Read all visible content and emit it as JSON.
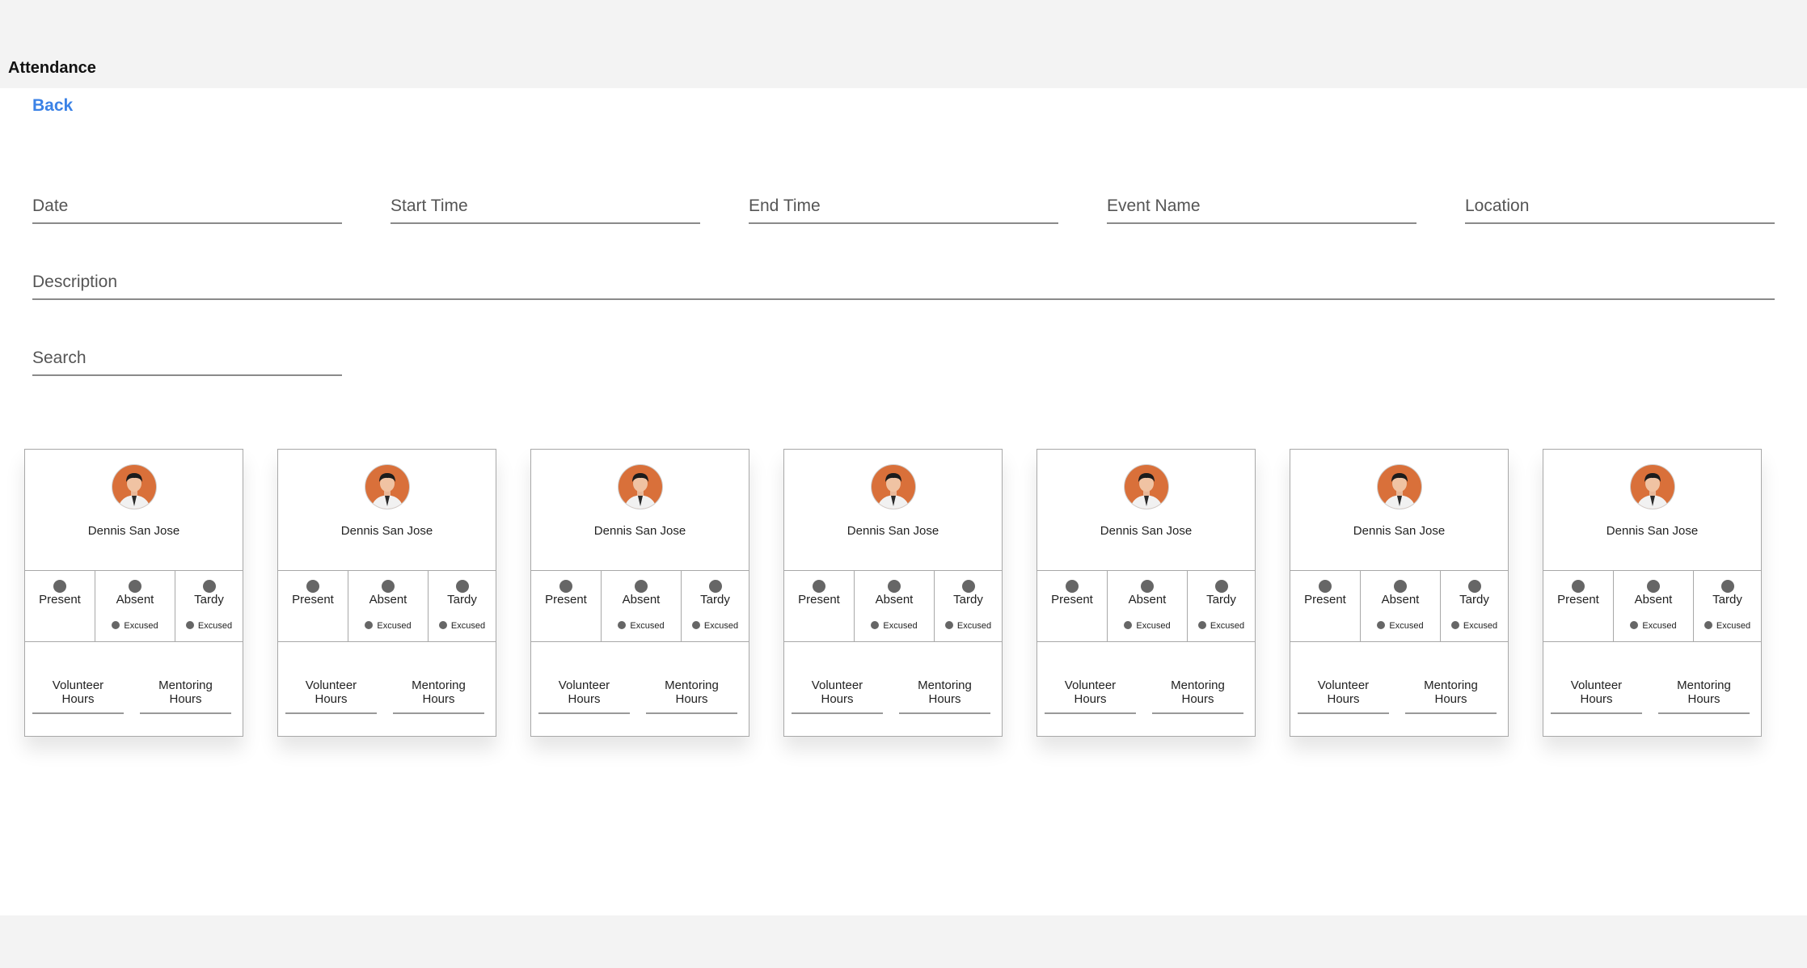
{
  "page": {
    "title": "Attendance",
    "back_label": "Back"
  },
  "form": {
    "date_placeholder": "Date",
    "start_time_placeholder": "Start Time",
    "end_time_placeholder": "End Time",
    "event_name_placeholder": "Event Name",
    "location_placeholder": "Location",
    "description_placeholder": "Description",
    "search_placeholder": "Search"
  },
  "status_labels": {
    "present": "Present",
    "absent": "Absent",
    "tardy": "Tardy",
    "excused": "Excused"
  },
  "hours_labels": {
    "volunteer_line1": "Volunteer",
    "volunteer_line2": "Hours",
    "mentoring_line1": "Mentoring",
    "mentoring_line2": "Hours"
  },
  "students": [
    {
      "name": "Dennis San Jose",
      "avatar_icon": "user-avatar-icon"
    },
    {
      "name": "Dennis San Jose",
      "avatar_icon": "user-avatar-icon"
    },
    {
      "name": "Dennis San Jose",
      "avatar_icon": "user-avatar-icon"
    },
    {
      "name": "Dennis San Jose",
      "avatar_icon": "user-avatar-icon"
    },
    {
      "name": "Dennis San Jose",
      "avatar_icon": "user-avatar-icon"
    },
    {
      "name": "Dennis San Jose",
      "avatar_icon": "user-avatar-icon"
    },
    {
      "name": "Dennis San Jose",
      "avatar_icon": "user-avatar-icon"
    }
  ],
  "colors": {
    "accent": "#3b82e6",
    "avatar_bg": "#d9703a",
    "radio": "#666666",
    "background": "#f3f3f3"
  }
}
